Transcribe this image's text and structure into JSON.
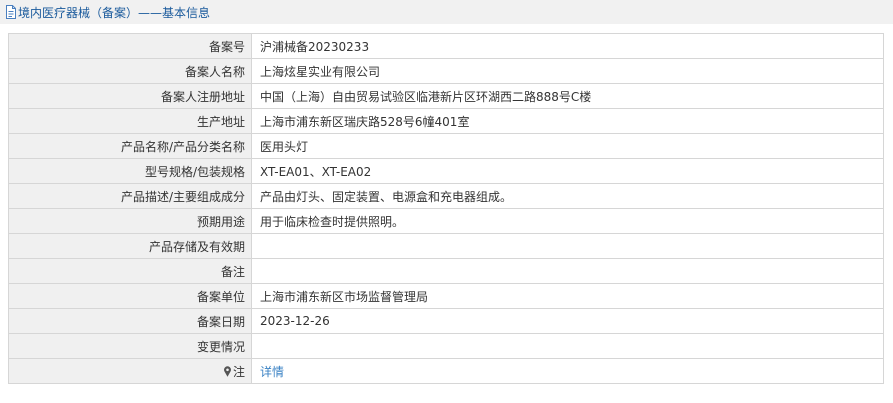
{
  "header": {
    "title": "境内医疗器械（备案）——基本信息",
    "icon": "document-icon"
  },
  "rows": [
    {
      "label": "备案号",
      "value": "沪浦械备20230233"
    },
    {
      "label": "备案人名称",
      "value": "上海炫星实业有限公司"
    },
    {
      "label": "备案人注册地址",
      "value": "中国（上海）自由贸易试验区临港新片区环湖西二路888号C楼"
    },
    {
      "label": "生产地址",
      "value": "上海市浦东新区瑞庆路528号6幢401室"
    },
    {
      "label": "产品名称/产品分类名称",
      "value": "医用头灯"
    },
    {
      "label": "型号规格/包装规格",
      "value": "XT-EA01、XT-EA02"
    },
    {
      "label": "产品描述/主要组成成分",
      "value": "产品由灯头、固定装置、电源盒和充电器组成。"
    },
    {
      "label": "预期用途",
      "value": "用于临床检查时提供照明。"
    },
    {
      "label": "产品存储及有效期",
      "value": ""
    },
    {
      "label": "备注",
      "value": ""
    },
    {
      "label": "备案单位",
      "value": "上海市浦东新区市场监督管理局"
    },
    {
      "label": "备案日期",
      "value": "2023-12-26"
    },
    {
      "label": "变更情况",
      "value": ""
    }
  ],
  "note_row": {
    "label": "注",
    "icon": "pin-icon",
    "link_text": "详情"
  },
  "colors": {
    "header_bg": "#f1f1f1",
    "header_text": "#1a5a9c",
    "label_bg": "#f0f0f0",
    "border": "#d6d6d6",
    "link": "#3a82c4"
  }
}
